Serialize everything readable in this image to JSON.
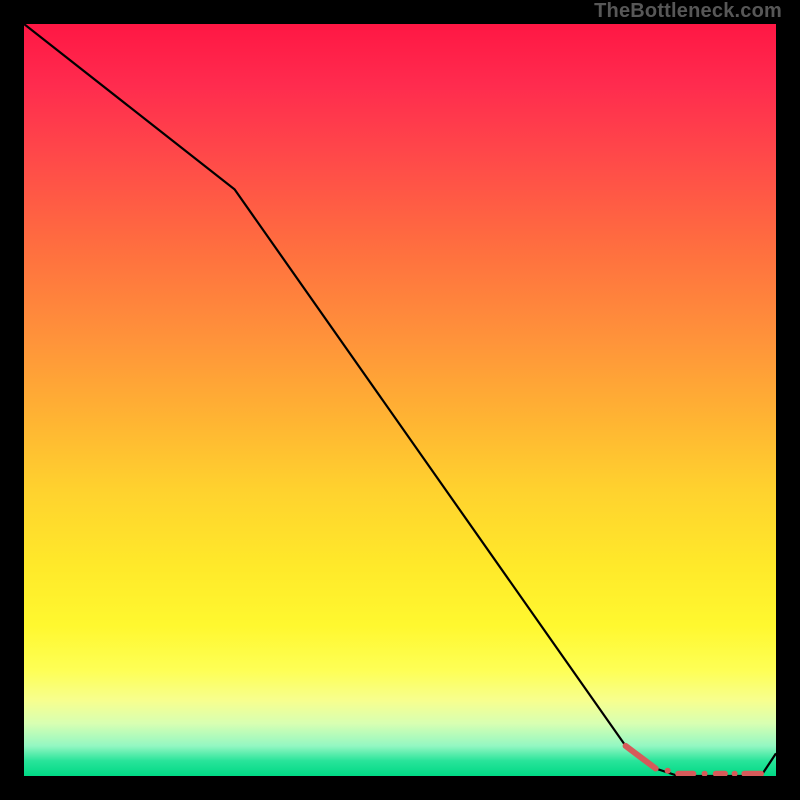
{
  "attribution": "TheBottleneck.com",
  "chart_data": {
    "type": "line",
    "title": "",
    "xlabel": "",
    "ylabel": "",
    "xlim": [
      0,
      100
    ],
    "ylim": [
      0,
      100
    ],
    "series": [
      {
        "name": "bottleneck-curve",
        "x": [
          0,
          28,
          80,
          84,
          87,
          89,
          91,
          93,
          98,
          100
        ],
        "y": [
          100,
          78,
          4,
          1,
          0,
          0,
          0,
          0,
          0,
          3
        ]
      }
    ],
    "optimal_band": {
      "name": "optimal-range",
      "segments": [
        {
          "x": [
            80,
            84
          ],
          "y": [
            4,
            1
          ]
        },
        {
          "x": [
            85.6,
            85.6
          ],
          "y": [
            0.7,
            0.7
          ]
        },
        {
          "x": [
            87.0,
            89.0
          ],
          "y": [
            0.3,
            0.3
          ]
        },
        {
          "x": [
            90.5,
            90.5
          ],
          "y": [
            0.3,
            0.3
          ]
        },
        {
          "x": [
            92.0,
            93.2
          ],
          "y": [
            0.3,
            0.3
          ]
        },
        {
          "x": [
            94.5,
            94.5
          ],
          "y": [
            0.3,
            0.3
          ]
        },
        {
          "x": [
            95.8,
            98.0
          ],
          "y": [
            0.3,
            0.3
          ]
        }
      ]
    },
    "gradient_stops": [
      {
        "pos": 0,
        "color": "#ff1744"
      },
      {
        "pos": 18,
        "color": "#ff4a49"
      },
      {
        "pos": 42,
        "color": "#ff933a"
      },
      {
        "pos": 72,
        "color": "#ffe92a"
      },
      {
        "pos": 90,
        "color": "#f7ff8f"
      },
      {
        "pos": 100,
        "color": "#00d985"
      }
    ]
  }
}
